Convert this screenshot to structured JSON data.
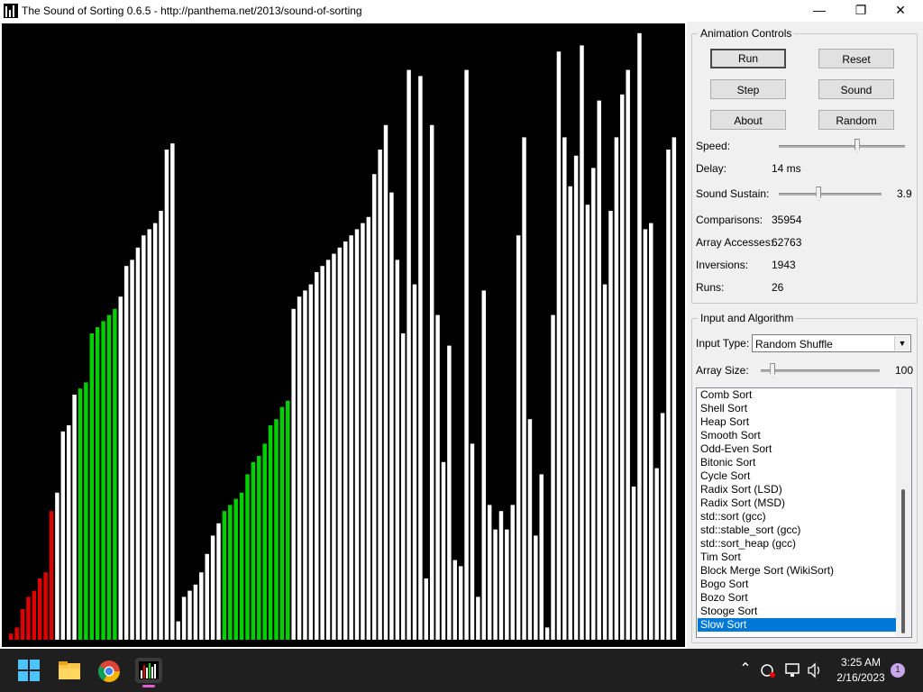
{
  "window": {
    "title": "The Sound of Sorting 0.6.5 - http://panthema.net/2013/sound-of-sorting",
    "minimize_glyph": "—",
    "maximize_glyph": "❐",
    "close_glyph": "✕"
  },
  "bars": {
    "heights": [
      1,
      2,
      5,
      7,
      8,
      10,
      11,
      21,
      24,
      34,
      35,
      40,
      41,
      42,
      50,
      51,
      52,
      53,
      54,
      56,
      61,
      62,
      64,
      66,
      67,
      68,
      70,
      80,
      81,
      3,
      7,
      8,
      9,
      11,
      14,
      17,
      19,
      21,
      22,
      23,
      24,
      27,
      29,
      30,
      32,
      35,
      36,
      38,
      39,
      54,
      56,
      57,
      58,
      60,
      61,
      62,
      63,
      64,
      65,
      66,
      67,
      68,
      69,
      76,
      80,
      84,
      73,
      62,
      50,
      93,
      58,
      92,
      10,
      84,
      53,
      29,
      48,
      13,
      12,
      93,
      32,
      7,
      57,
      22,
      18,
      21,
      18,
      22,
      66,
      82,
      36,
      17,
      27,
      2,
      53,
      96,
      82,
      74,
      79,
      97,
      71,
      77,
      88,
      58,
      70,
      82,
      89,
      93,
      25,
      99,
      67,
      68,
      28,
      37,
      80,
      82
    ]
  },
  "colors": {
    "accent": "#0078d7",
    "bar_normal": "#ffffff",
    "bar_red": "#e00000",
    "bar_green": "#00d000",
    "canvas_bg": "#000000",
    "taskbar_bg": "#1f1f1f"
  },
  "animation_controls": {
    "title": "Animation Controls",
    "run_label": "Run",
    "reset_label": "Reset",
    "step_label": "Step",
    "sound_label": "Sound",
    "about_label": "About",
    "random_label": "Random",
    "speed_label": "Speed:",
    "speed_level": 0.62,
    "delay_label": "Delay:",
    "delay_value": "14 ms",
    "sustain_label": "Sound Sustain:",
    "sustain_level": 0.39,
    "sustain_value": "3.9",
    "comparisons_label": "Comparisons:",
    "comparisons_value": "35954",
    "accesses_label": "Array Accesses:",
    "accesses_value": "62763",
    "inversions_label": "Inversions:",
    "inversions_value": "1943",
    "runs_label": "Runs:",
    "runs_value": "26"
  },
  "input_algorithm": {
    "title": "Input and Algorithm",
    "input_type_label": "Input Type:",
    "input_type_value": "Random Shuffle",
    "array_size_label": "Array Size:",
    "array_size_level": 0.1,
    "array_size_value": "100",
    "algorithms": [
      "Comb Sort",
      "Shell Sort",
      "Heap Sort",
      "Smooth Sort",
      "Odd-Even Sort",
      "Bitonic Sort",
      "Cycle Sort",
      "Radix Sort (LSD)",
      "Radix Sort (MSD)",
      "std::sort (gcc)",
      "std::stable_sort (gcc)",
      "std::sort_heap (gcc)",
      "Tim Sort",
      "Block Merge Sort (WikiSort)",
      "Bogo Sort",
      "Bozo Sort",
      "Stooge Sort",
      "Slow Sort"
    ],
    "selected_algorithm": "Slow Sort"
  },
  "taskbar": {
    "icons": [
      "windows-start-icon",
      "file-explorer-icon",
      "chrome-icon",
      "sound-of-sorting-app-icon"
    ],
    "time": "3:25 AM",
    "date": "2/16/2023",
    "notification_count": "1",
    "chevron_glyph": "⌃"
  }
}
